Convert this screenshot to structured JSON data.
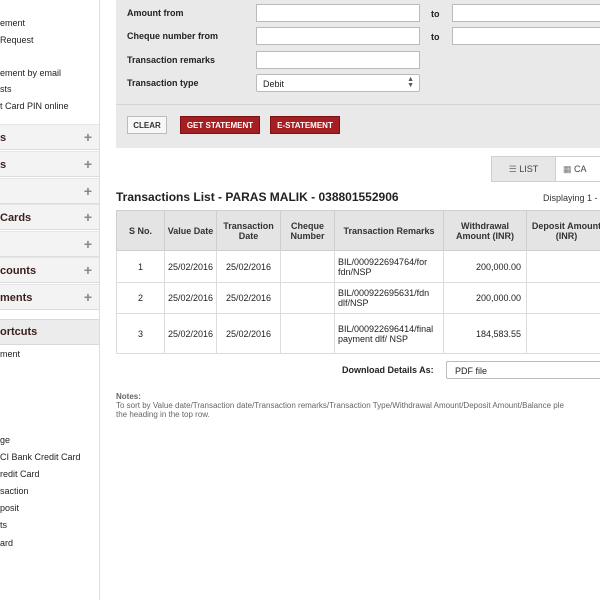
{
  "sidebar": {
    "links_top": [
      "ement",
      "Request",
      "ement by email",
      "sts",
      "t Card PIN online"
    ],
    "sections": [
      "s",
      "s",
      "",
      "Cards",
      "",
      "counts",
      "ments"
    ],
    "shortcuts_label": "ortcuts",
    "shortcut_links": [
      "ment",
      "ge",
      "CI Bank Credit Card",
      "redit Card",
      "saction",
      "posit",
      "ts",
      "ard"
    ]
  },
  "filter": {
    "amount_from_label": "Amount from",
    "cheque_from_label": "Cheque number from",
    "remarks_label": "Transaction remarks",
    "type_label": "Transaction type",
    "to_label": "to",
    "type_value": "Debit"
  },
  "buttons": {
    "clear": "CLEAR",
    "get_statement": "GET STATEMENT",
    "e_statement": "E-STATEMENT"
  },
  "view_toggle": {
    "list": "LIST",
    "calendar": "CA"
  },
  "transactions": {
    "title": "Transactions List - PARAS MALIK - 038801552906",
    "displaying": "Displaying 1 -",
    "columns": {
      "s_no": "S No.",
      "value_date": "Value Date",
      "transaction_date": "Transaction Date",
      "cheque_number": "Cheque Number",
      "remarks": "Transaction Remarks",
      "withdrawal": "Withdrawal Amount (INR)",
      "deposit": "Deposit Amount (INR)"
    },
    "rows": [
      {
        "s_no": "1",
        "value_date": "25/02/2016",
        "transaction_date": "25/02/2016",
        "cheque": "",
        "remarks": "BIL/000922694764/for fdn/NSP",
        "withdrawal": "200,000.00",
        "deposit": ""
      },
      {
        "s_no": "2",
        "value_date": "25/02/2016",
        "transaction_date": "25/02/2016",
        "cheque": "",
        "remarks": "BIL/000922695631/fdn dlf/NSP",
        "withdrawal": "200,000.00",
        "deposit": ""
      },
      {
        "s_no": "3",
        "value_date": "25/02/2016",
        "transaction_date": "25/02/2016",
        "cheque": "",
        "remarks": "BIL/000922696414/final payment dlf/ NSP",
        "withdrawal": "184,583.55",
        "deposit": ""
      }
    ]
  },
  "download": {
    "label": "Download Details As:",
    "value": "PDF file"
  },
  "notes": {
    "heading": "Notes:",
    "line1": "To sort by Value date/Transaction date/Transaction remarks/Transaction Type/Withdrawal Amount/Deposit Amount/Balance ple",
    "line2": "the heading in the top row."
  }
}
